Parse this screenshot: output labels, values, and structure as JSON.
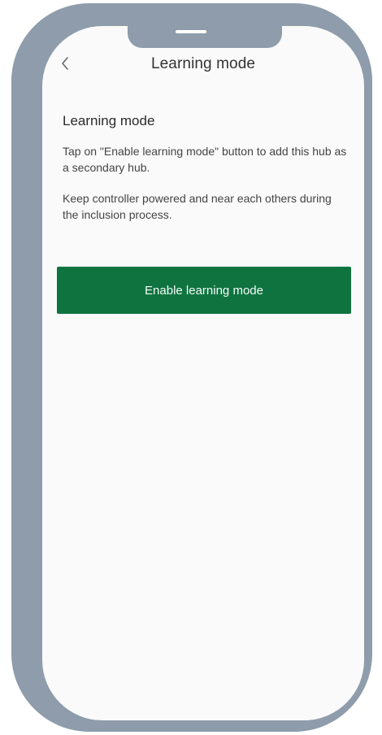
{
  "header": {
    "back_icon": "chevron-left-icon",
    "title": "Learning mode"
  },
  "main": {
    "heading": "Learning mode",
    "paragraph1": "Tap on \"Enable learning mode\" button to add this hub as a secondary hub.",
    "paragraph2": "Keep controller powered and near each others during the inclusion process.",
    "enable_button_label": "Enable learning mode"
  },
  "colors": {
    "frame": "#8e9cab",
    "screen_background": "#fafafa",
    "primary_button": "#0f7340",
    "primary_text": "#333333"
  }
}
